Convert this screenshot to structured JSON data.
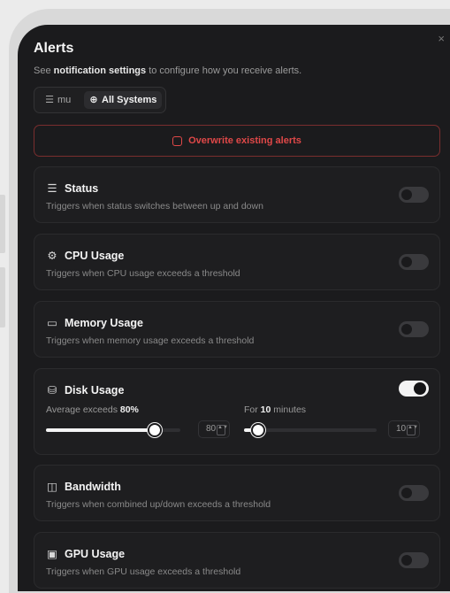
{
  "dialog": {
    "title": "Alerts",
    "subtitle_prefix": "See ",
    "subtitle_link": "notification settings",
    "subtitle_suffix": " to configure how you receive alerts.",
    "close_glyph": "×"
  },
  "tabs": [
    {
      "label": "mu",
      "icon": "server-icon",
      "glyph": "☰",
      "active": false
    },
    {
      "label": "All Systems",
      "icon": "globe-icon",
      "glyph": "⊕",
      "active": true
    }
  ],
  "overwrite": {
    "label": "Overwrite existing alerts",
    "checked": false
  },
  "alerts": {
    "status": {
      "title": "Status",
      "icon": "server-icon",
      "glyph": "☰",
      "desc": "Triggers when status switches between up and down",
      "enabled": false
    },
    "cpu": {
      "title": "CPU Usage",
      "icon": "cpu-icon",
      "glyph": "⚙",
      "desc": "Triggers when CPU usage exceeds a threshold",
      "enabled": false
    },
    "memory": {
      "title": "Memory Usage",
      "icon": "memory-icon",
      "glyph": "▭",
      "desc": "Triggers when memory usage exceeds a threshold",
      "enabled": false
    },
    "disk": {
      "title": "Disk Usage",
      "icon": "disk-icon",
      "glyph": "⛁",
      "enabled": true,
      "threshold_prefix": "Average exceeds ",
      "threshold_value": "80%",
      "duration_prefix": "For ",
      "duration_value": "10",
      "duration_suffix": " minutes",
      "threshold_input": "80",
      "duration_input": "10",
      "threshold_level": 0.8,
      "duration_level": 0.1
    },
    "bandwidth": {
      "title": "Bandwidth",
      "icon": "network-icon",
      "glyph": "◫",
      "desc": "Triggers when combined up/down exceeds a threshold",
      "enabled": false
    },
    "gpu": {
      "title": "GPU Usage",
      "icon": "gpu-icon",
      "glyph": "▣",
      "desc": "Triggers when GPU usage exceeds a threshold",
      "enabled": false
    }
  }
}
